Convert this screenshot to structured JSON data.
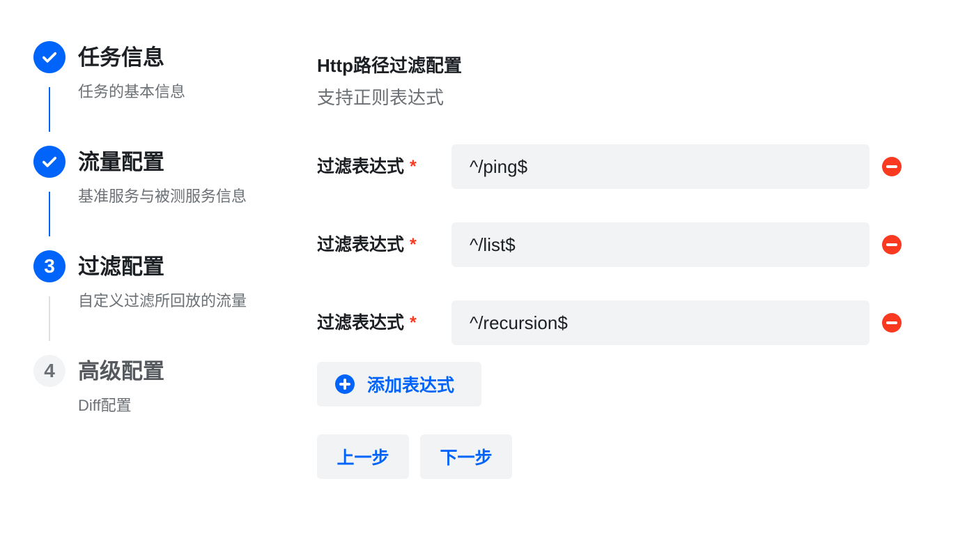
{
  "steps": [
    {
      "number": "1",
      "title": "任务信息",
      "description": "任务的基本信息",
      "status": "done",
      "icon": "check-icon"
    },
    {
      "number": "2",
      "title": "流量配置",
      "description": "基准服务与被测服务信息",
      "status": "done",
      "icon": "check-icon"
    },
    {
      "number": "3",
      "title": "过滤配置",
      "description": "自定义过滤所回放的流量",
      "status": "active"
    },
    {
      "number": "4",
      "title": "高级配置",
      "description": "Diff配置",
      "status": "wait"
    }
  ],
  "form": {
    "title": "Http路径过滤配置",
    "subtitle": "支持正则表达式",
    "rows": [
      {
        "label": "过滤表达式",
        "required": "*",
        "value": "^/ping$",
        "remove_icon": "minus-circle-icon"
      },
      {
        "label": "过滤表达式",
        "required": "*",
        "value": "^/list$",
        "remove_icon": "minus-circle-icon"
      },
      {
        "label": "过滤表达式",
        "required": "*",
        "value": "^/recursion$",
        "remove_icon": "minus-circle-icon"
      }
    ],
    "add_label": "添加表达式",
    "add_icon": "plus-circle-icon",
    "prev_label": "上一步",
    "next_label": "下一步"
  },
  "colors": {
    "primary": "#0064fa",
    "danger": "#f93920",
    "input_bg": "#f2f3f5",
    "text_secondary": "#6b7075"
  }
}
